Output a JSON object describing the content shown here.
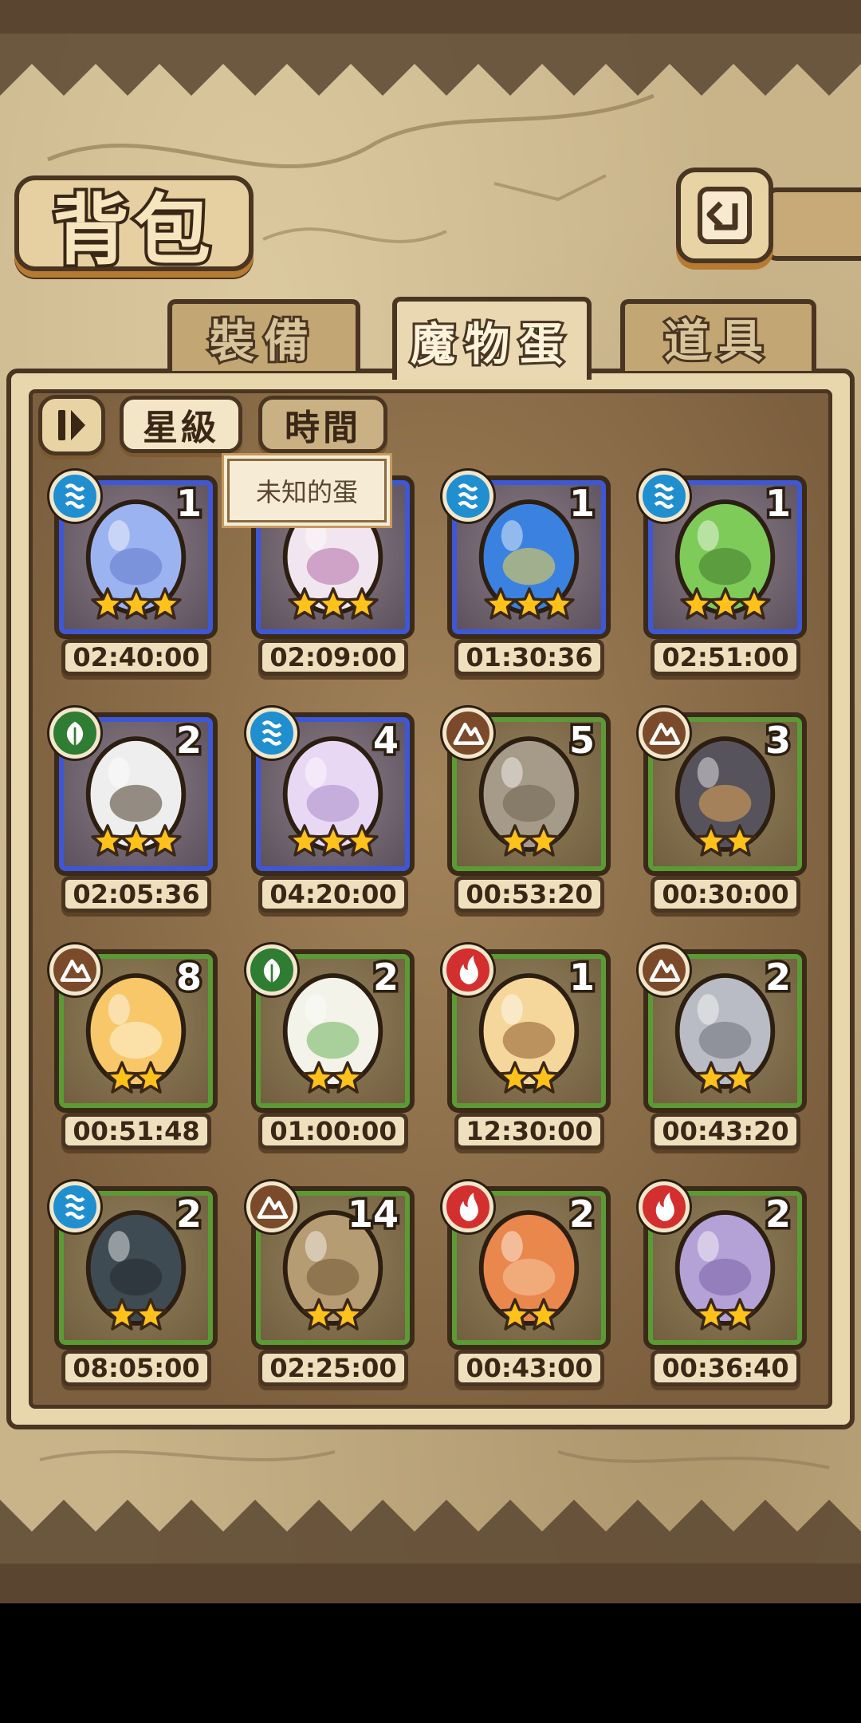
{
  "screen": {
    "title": "背包",
    "back_icon": "back-arrow-icon"
  },
  "tabs": [
    {
      "label": "裝備",
      "active": false
    },
    {
      "label": "魔物蛋",
      "active": true
    },
    {
      "label": "道具",
      "active": false
    }
  ],
  "sort": {
    "toggle_icon": "sort-order-icon",
    "options": [
      {
        "label": "星級",
        "selected": true
      },
      {
        "label": "時間",
        "selected": false
      }
    ]
  },
  "tooltip": {
    "text": "未知的蛋"
  },
  "colors": {
    "water": "#1f8fd0",
    "grass": "#2e7d32",
    "earth": "#7a4a2a",
    "fire": "#d32f2f",
    "star": "#ffc21a",
    "rare_border": "#3d57d6",
    "common_border": "#5b9a35"
  },
  "eggs": [
    {
      "element": "water",
      "count": "1",
      "stars": 3,
      "time": "02:40:00",
      "frame": "blue",
      "art": "crystal-egg-icon"
    },
    {
      "element": "water",
      "count": "",
      "stars": 3,
      "time": "02:09:00",
      "frame": "blue",
      "art": "mushroom-egg-icon"
    },
    {
      "element": "water",
      "count": "1",
      "stars": 3,
      "time": "01:30:36",
      "frame": "blue",
      "art": "eye-egg-icon"
    },
    {
      "element": "water",
      "count": "1",
      "stars": 3,
      "time": "02:51:00",
      "frame": "blue",
      "art": "slime-egg-icon"
    },
    {
      "element": "grass",
      "count": "2",
      "stars": 3,
      "time": "02:05:36",
      "frame": "blue",
      "art": "spiked-egg-icon"
    },
    {
      "element": "water",
      "count": "4",
      "stars": 3,
      "time": "04:20:00",
      "frame": "blue",
      "art": "jellyfish-egg-icon"
    },
    {
      "element": "earth",
      "count": "5",
      "stars": 2,
      "time": "00:53:20",
      "frame": "green",
      "art": "rock-egg-icon"
    },
    {
      "element": "earth",
      "count": "3",
      "stars": 2,
      "time": "00:30:00",
      "frame": "green",
      "art": "hat-egg-icon"
    },
    {
      "element": "earth",
      "count": "8",
      "stars": 2,
      "time": "00:51:48",
      "frame": "green",
      "art": "bandaged-egg-icon"
    },
    {
      "element": "grass",
      "count": "2",
      "stars": 2,
      "time": "01:00:00",
      "frame": "green",
      "art": "radish-egg-icon"
    },
    {
      "element": "fire",
      "count": "1",
      "stars": 2,
      "time": "12:30:00",
      "frame": "green",
      "art": "pudding-egg-icon"
    },
    {
      "element": "earth",
      "count": "2",
      "stars": 2,
      "time": "00:43:20",
      "frame": "green",
      "art": "stone-spiral-egg-icon"
    },
    {
      "element": "water",
      "count": "2",
      "stars": 2,
      "time": "08:05:00",
      "frame": "green",
      "art": "turtle-shell-egg-icon"
    },
    {
      "element": "earth",
      "count": "14",
      "stars": 2,
      "time": "02:25:00",
      "frame": "green",
      "art": "wooden-egg-icon"
    },
    {
      "element": "fire",
      "count": "2",
      "stars": 2,
      "time": "00:43:00",
      "frame": "green",
      "art": "crab-egg-icon"
    },
    {
      "element": "fire",
      "count": "2",
      "stars": 2,
      "time": "00:36:40",
      "frame": "green",
      "art": "flower-bud-egg-icon"
    }
  ]
}
